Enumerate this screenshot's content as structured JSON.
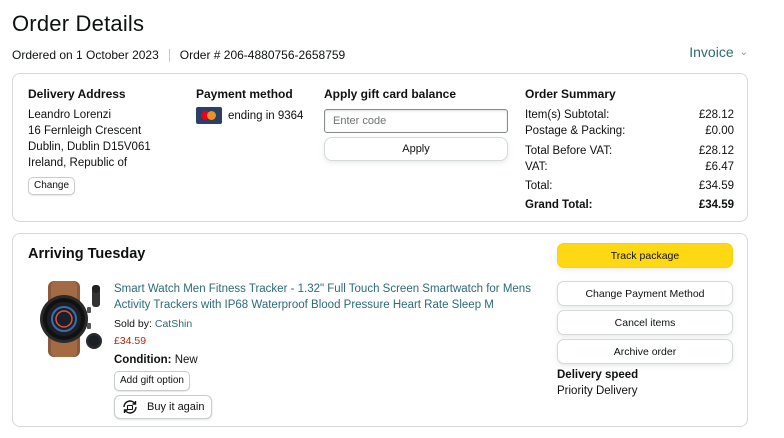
{
  "header": {
    "title": "Order Details",
    "ordered_on": "Ordered on 1 October 2023",
    "order_number": "Order # 206-4880756-2658759",
    "invoice_label": "Invoice"
  },
  "delivery": {
    "heading": "Delivery Address",
    "name": "Leandro Lorenzi",
    "line1": "16 Fernleigh Crescent",
    "line2": "Dublin, Dublin D15V061",
    "line3": "Ireland, Republic of",
    "change_label": "Change"
  },
  "payment": {
    "heading": "Payment method",
    "card_text": "ending in 9364",
    "card_icon": "mastercard-icon"
  },
  "gift_card": {
    "heading": "Apply gift card balance",
    "placeholder": "Enter code",
    "value": "",
    "apply_label": "Apply"
  },
  "summary": {
    "heading": "Order Summary",
    "rows": [
      {
        "label": "Item(s) Subtotal:",
        "value": "£28.12"
      },
      {
        "label": "Postage & Packing:",
        "value": "£0.00"
      },
      {
        "label": "Total Before VAT:",
        "value": "£28.12"
      },
      {
        "label": "VAT:",
        "value": "£6.47"
      },
      {
        "label": "Total:",
        "value": "£34.59"
      },
      {
        "label": "Grand Total:",
        "value": "£34.59"
      }
    ]
  },
  "shipment": {
    "heading": "Arriving Tuesday",
    "product": {
      "title": "Smart Watch Men Fitness Tracker - 1.32\" Full Touch Screen Smartwatch for Mens Activity Trackers with IP68 Waterproof Blood Pressure Heart Rate Sleep M",
      "sold_by_label": "Sold by:",
      "seller": "CatShin",
      "price": "£34.59",
      "condition_label": "Condition:",
      "condition_value": "New",
      "gift_option_label": "Add gift option",
      "buy_again_label": "Buy it again"
    },
    "actions": {
      "track_label": "Track package",
      "change_payment_label": "Change Payment Method",
      "cancel_label": "Cancel items",
      "archive_label": "Archive order"
    },
    "delivery_speed_heading": "Delivery speed",
    "delivery_speed_value": "Priority Delivery"
  },
  "colors": {
    "link": "#2a6b77",
    "price": "#b12704",
    "primary_button": "#ffd814",
    "border": "#d5d9d9"
  }
}
